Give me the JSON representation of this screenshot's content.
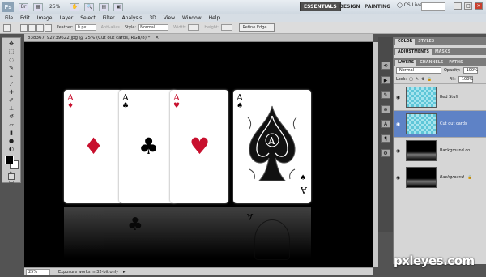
{
  "app": {
    "logo": "Ps",
    "zoom": "25%"
  },
  "workspaces": [
    "ESSENTIALS",
    "DESIGN",
    "PAINTING"
  ],
  "cs_live": "CS Live",
  "menu": [
    "File",
    "Edit",
    "Image",
    "Layer",
    "Select",
    "Filter",
    "Analysis",
    "3D",
    "View",
    "Window",
    "Help"
  ],
  "options": {
    "feather_label": "Feather:",
    "feather_value": "0 px",
    "antialias": "Anti-alias",
    "style_label": "Style:",
    "style_value": "Normal",
    "width_label": "Width:",
    "height_label": "Height:",
    "refine_edge": "Refine Edge..."
  },
  "document": {
    "tab_title": "838367_92739622.jpg @ 25% (Cut out cards, RGB/8) *",
    "close": "×"
  },
  "status": {
    "zoom": "25%",
    "message": "Exposure works in 32-bit only"
  },
  "cards": [
    {
      "rank": "A",
      "suit": "♦",
      "color": "#c8102e"
    },
    {
      "rank": "A",
      "suit": "♣",
      "color": "#000000"
    },
    {
      "rank": "A",
      "suit": "♥",
      "color": "#c8102e"
    },
    {
      "rank": "A",
      "suit": "♠",
      "color": "#000000"
    }
  ],
  "panels": {
    "top_tabs": [
      "COLOR",
      "STYLES"
    ],
    "mid_tabs": [
      "ADJUSTMENTS",
      "MASKS"
    ],
    "layer_tabs": [
      "LAYERS",
      "CHANNELS",
      "PATHS"
    ],
    "blend_mode": "Normal",
    "opacity_label": "Opacity:",
    "opacity_value": "100%",
    "lock_label": "Lock:",
    "fill_label": "Fill:",
    "fill_value": "100%",
    "layers": [
      {
        "name": "Red Stuff",
        "selected": false
      },
      {
        "name": "Cut out cards",
        "selected": true
      },
      {
        "name": "Background co...",
        "selected": false
      },
      {
        "name": "Background",
        "selected": false
      }
    ]
  },
  "watermark": "pxleyes.com"
}
